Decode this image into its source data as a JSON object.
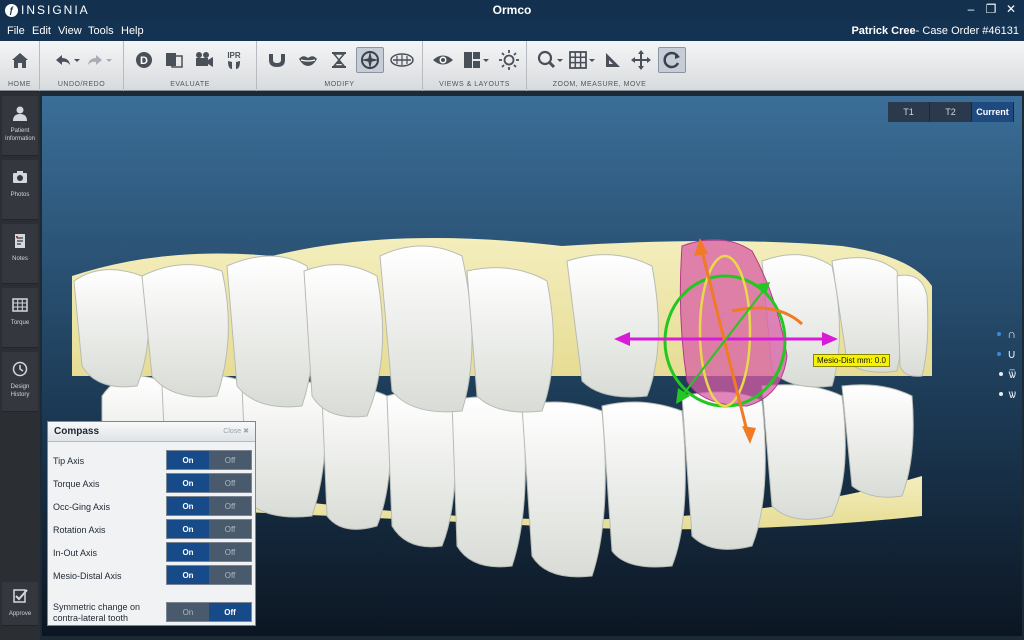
{
  "window": {
    "logo_text": "INSIGNIA",
    "title": "Ormco"
  },
  "menu": {
    "items": [
      "File",
      "Edit",
      "View",
      "Tools",
      "Help"
    ]
  },
  "case": {
    "patient": "Patrick Cree",
    "order": "- Case Order #46131"
  },
  "toolbar": {
    "groups": {
      "home": "HOME",
      "undo_redo": "UNDO/REDO",
      "evaluate": "EVALUATE",
      "modify": "MODIFY",
      "views": "VIEWS & LAYOUTS",
      "zoom": "ZOOM, MEASURE, MOVE"
    },
    "ipr_label": "IPR",
    "d_label": "D"
  },
  "sidebar": {
    "items": [
      {
        "label": "Patient Information",
        "icon": "person-icon"
      },
      {
        "label": "Photos",
        "icon": "camera-icon"
      },
      {
        "label": "Notes",
        "icon": "notes-icon"
      },
      {
        "label": "Torque",
        "icon": "grid-icon"
      },
      {
        "label": "Design History",
        "icon": "history-icon"
      }
    ],
    "approve": "Approve"
  },
  "view_tabs": {
    "t1": "T1",
    "t2": "T2",
    "current": "Current"
  },
  "measure": {
    "label": "Mesio-Dist mm:",
    "value": "0.0"
  },
  "compass": {
    "title": "Compass",
    "close": "Close",
    "on": "On",
    "off": "Off",
    "rows": [
      {
        "label": "Tip Axis",
        "state": "On"
      },
      {
        "label": "Torque Axis",
        "state": "On"
      },
      {
        "label": "Occ-Ging Axis",
        "state": "On"
      },
      {
        "label": "Rotation Axis",
        "state": "On"
      },
      {
        "label": "In-Out Axis",
        "state": "On"
      },
      {
        "label": "Mesio-Distal Axis",
        "state": "On"
      }
    ],
    "symmetric": {
      "label": "Symmetric change on contra-lateral tooth",
      "state": "Off"
    }
  },
  "colors": {
    "title_bar": "#13314f",
    "active_toggle": "#174a88",
    "teeth": "#eef0ea",
    "gum": "#f0eab0",
    "selected_tooth": "#d85ca5",
    "arrow_magenta": "#d81bd8",
    "arrow_orange": "#f07a26",
    "ring_green": "#22c722",
    "ring_yellow": "#e8d84a"
  }
}
